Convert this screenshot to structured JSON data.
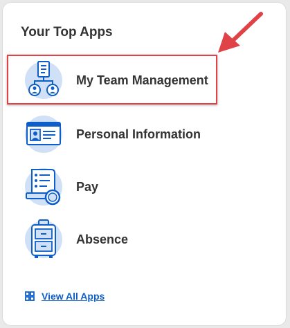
{
  "card": {
    "title": "Your Top Apps"
  },
  "apps": [
    {
      "label": "My Team Management",
      "icon": "team-management-icon",
      "highlighted": true
    },
    {
      "label": "Personal Information",
      "icon": "id-card-icon"
    },
    {
      "label": "Pay",
      "icon": "pay-receipt-icon"
    },
    {
      "label": "Absence",
      "icon": "luggage-icon"
    }
  ],
  "view_all": {
    "label": "View All Apps",
    "icon": "grid-icon"
  },
  "annotation": {
    "icon": "red-arrow-icon"
  },
  "colors": {
    "accent_blue": "#0e5ec9",
    "icon_fill": "#cfe0f7",
    "icon_stroke": "#0e5ec9",
    "highlight": "#e04347",
    "title_text": "#333333"
  }
}
